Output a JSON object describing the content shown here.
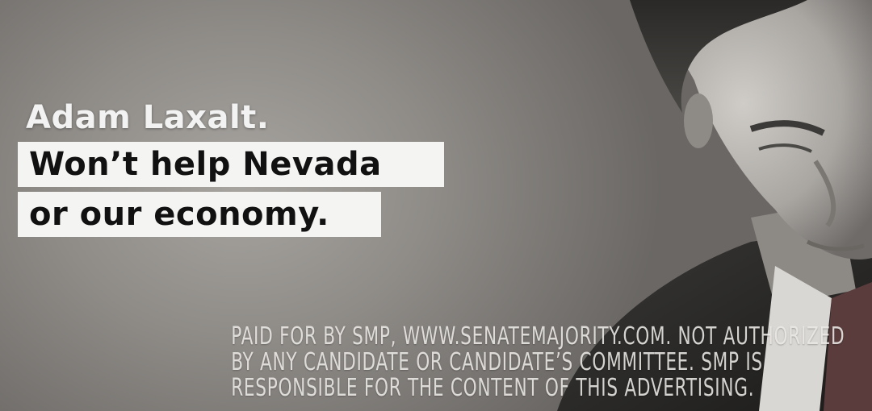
{
  "headline": {
    "name": "Adam Laxalt.",
    "line1": "Won’t help Nevada",
    "line2": "or our economy."
  },
  "disclaimer": {
    "line1": "PAID FOR BY SMP, WWW.SENATEMAJORITY.COM. NOT AUTHORIZED",
    "line2": "BY ANY CANDIDATE OR CANDIDATE’S COMMITTEE. SMP IS",
    "line3": "RESPONSIBLE FOR THE CONTENT OF THIS ADVERTISING."
  },
  "colors": {
    "background": "#8f8c88",
    "bar": "#f4f4f2",
    "bar_text": "#111111",
    "name_text": "#f2f2f2"
  }
}
